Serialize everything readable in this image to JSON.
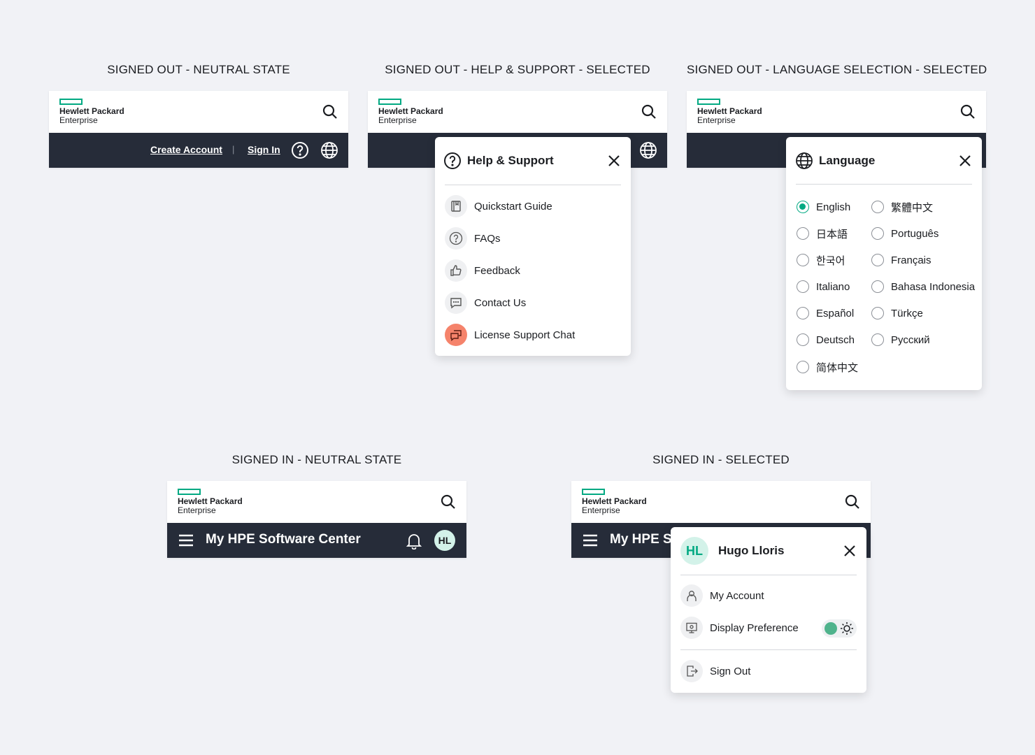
{
  "captions": [
    "SIGNED OUT - NEUTRAL STATE",
    "SIGNED OUT - HELP & SUPPORT - SELECTED",
    "SIGNED OUT - LANGUAGE SELECTION - SELECTED",
    "SIGNED IN - NEUTRAL STATE",
    "SIGNED IN - SELECTED"
  ],
  "brand": {
    "line1": "Hewlett Packard",
    "line2": "Enterprise",
    "accent": "#01a982",
    "bar_color": "#262c39"
  },
  "signed_out": {
    "create_account": "Create Account",
    "separator": "|",
    "sign_in": "Sign In"
  },
  "help_panel": {
    "title": "Help & Support",
    "items": [
      {
        "label": "Quickstart Guide",
        "icon": "book-icon"
      },
      {
        "label": "FAQs",
        "icon": "question-icon"
      },
      {
        "label": "Feedback",
        "icon": "thumbs-up-icon"
      },
      {
        "label": "Contact Us",
        "icon": "chat-bubble-icon"
      },
      {
        "label": "License Support Chat",
        "icon": "chat-support-icon"
      }
    ]
  },
  "language_panel": {
    "title": "Language",
    "selected": "English",
    "options": [
      "English",
      "繁體中文",
      "日本語",
      "Português",
      "한국어",
      "Français",
      "Italiano",
      "Bahasa Indonesia",
      "Español",
      "Türkçe",
      "Deutsch",
      "Русский",
      "简体中文"
    ]
  },
  "signed_in": {
    "app_title": "My HPE Software Center",
    "app_title_clipped": "My HPE So",
    "initials": "HL"
  },
  "user_panel": {
    "name": "Hugo Lloris",
    "initials": "HL",
    "items": [
      "My Account",
      "Display Preference",
      "Sign Out"
    ]
  }
}
